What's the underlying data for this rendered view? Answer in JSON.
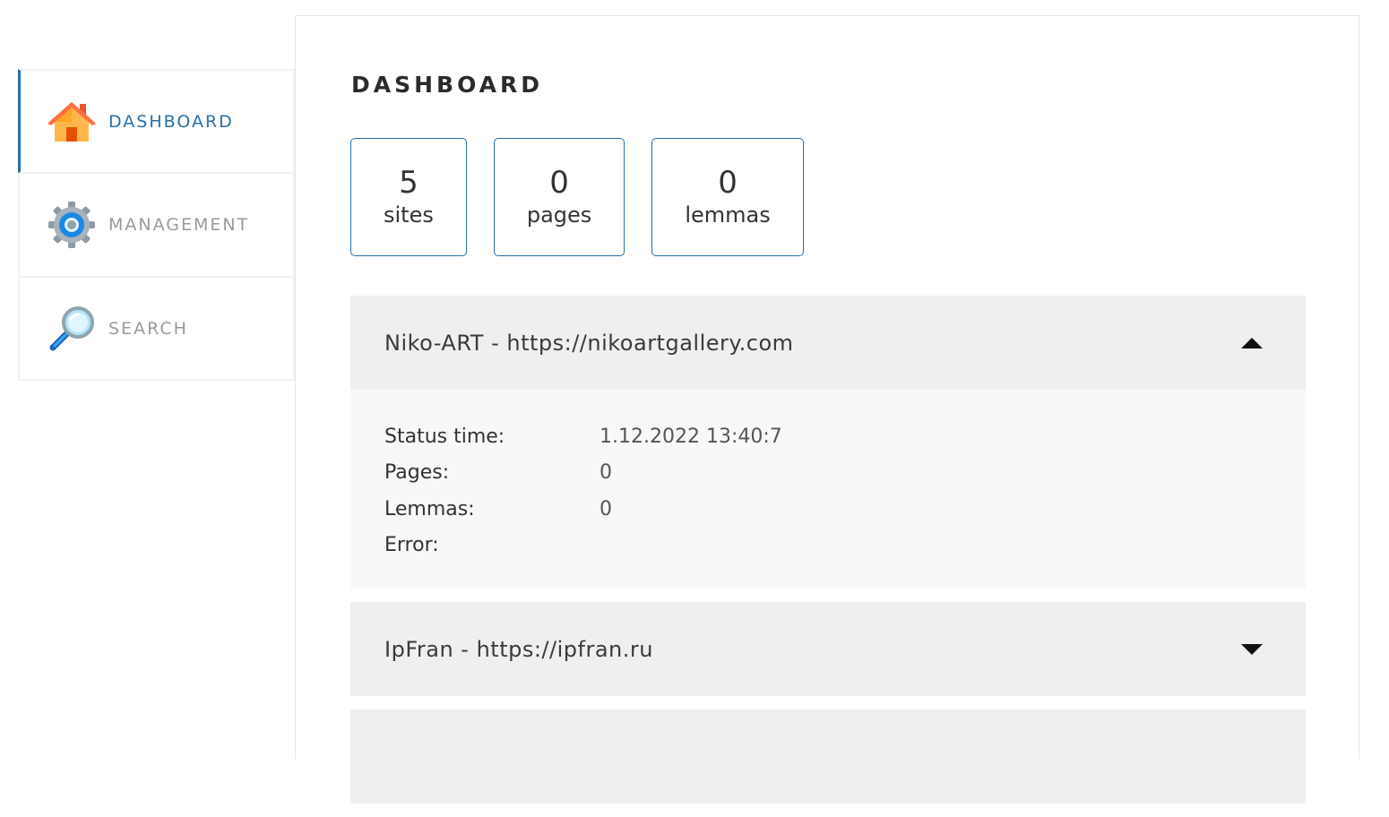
{
  "sidebar": {
    "items": [
      {
        "label": "DASHBOARD",
        "icon": "home-icon",
        "active": true
      },
      {
        "label": "MANAGEMENT",
        "icon": "gear-icon",
        "active": false
      },
      {
        "label": "SEARCH",
        "icon": "magnifier-icon",
        "active": false
      }
    ]
  },
  "main": {
    "title": "DASHBOARD",
    "stats": [
      {
        "value": "5",
        "label": "sites"
      },
      {
        "value": "0",
        "label": "pages"
      },
      {
        "value": "0",
        "label": "lemmas"
      }
    ],
    "sites": [
      {
        "title": "Niko-ART - https://nikoartgallery.com",
        "expanded": true,
        "details": {
          "status_time_label": "Status time:",
          "status_time": "1.12.2022 13:40:7",
          "pages_label": "Pages:",
          "pages": "0",
          "lemmas_label": "Lemmas:",
          "lemmas": "0",
          "error_label": "Error:",
          "error": ""
        }
      },
      {
        "title": "IpFran - https://ipfran.ru",
        "expanded": false
      },
      {
        "title": "",
        "expanded": false
      }
    ]
  },
  "colors": {
    "accent": "#2a6fa5",
    "panel_bg": "#efefef",
    "body_bg": "#f8f8f8"
  }
}
